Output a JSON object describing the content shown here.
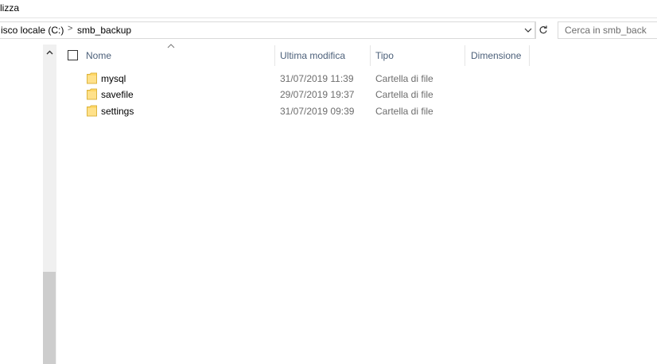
{
  "ribbon": {
    "tab_label": "lizza"
  },
  "address_bar": {
    "crumbs": [
      "isco locale (C:)",
      "smb_backup"
    ],
    "separator": ">"
  },
  "search": {
    "placeholder": "Cerca in smb_back"
  },
  "columns": {
    "name": "Nome",
    "modified": "Ultima modifica",
    "type": "Tipo",
    "size": "Dimensione"
  },
  "files": [
    {
      "name": "mysql",
      "modified": "31/07/2019 11:39",
      "type": "Cartella di file",
      "size": ""
    },
    {
      "name": "savefile",
      "modified": "29/07/2019 19:37",
      "type": "Cartella di file",
      "size": ""
    },
    {
      "name": "settings",
      "modified": "31/07/2019 09:39",
      "type": "Cartella di file",
      "size": ""
    }
  ],
  "icons": {
    "folder": "folder-icon",
    "dropdown": "chevron-down-icon",
    "refresh": "refresh-icon",
    "scroll_up": "scroll-up-icon",
    "sort": "sort-ascending-icon"
  },
  "colors": {
    "header_text": "#4c607a",
    "meta_text": "#6d6d6d",
    "folder_fill": "#ffd766",
    "scroll_thumb": "#cdcdcd"
  }
}
